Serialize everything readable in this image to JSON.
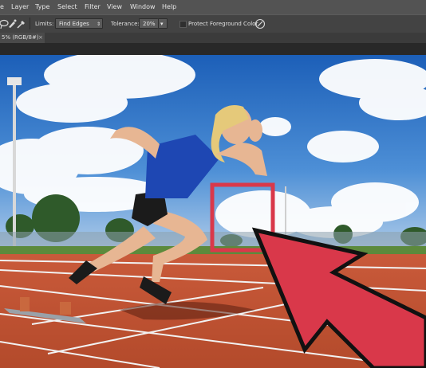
{
  "menu": {
    "items": [
      {
        "label": "e"
      },
      {
        "label": "Layer"
      },
      {
        "label": "Type"
      },
      {
        "label": "Select"
      },
      {
        "label": "Filter"
      },
      {
        "label": "View"
      },
      {
        "label": "Window"
      },
      {
        "label": "Help"
      }
    ]
  },
  "options": {
    "tool_icons": [
      "lasso-icon",
      "brush-icon",
      "eyedropper-icon"
    ],
    "limits_label": "Limits:",
    "limits_value": "Find Edges",
    "tolerance_label": "Tolerance:",
    "tolerance_value": "20%",
    "protect_label": "Protect Foreground Color",
    "protect_checked": false
  },
  "document_tab": {
    "label": "5% (RGB/8#)",
    "close": "×"
  },
  "colors": {
    "menubar_bg": "#535353",
    "optionsbar_bg": "#434343",
    "workspace_bg": "#282828",
    "highlight_red": "#d9384a"
  }
}
